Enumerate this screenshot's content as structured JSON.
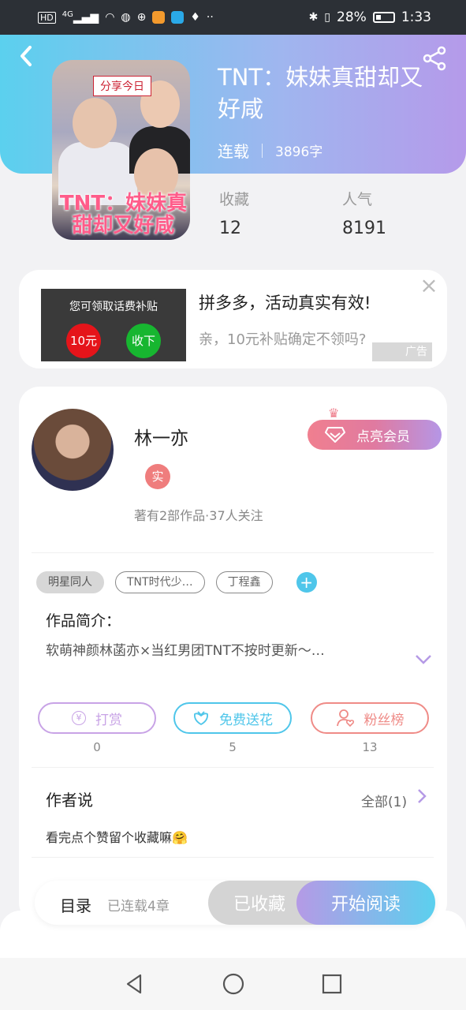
{
  "status_bar": {
    "hd": "HD",
    "signal": "4G",
    "battery": "28%",
    "time": "1:33"
  },
  "book": {
    "title": "TNT：妹妹真甜却又好咸",
    "status": "连载",
    "words": "3896字",
    "cover_tag": "分享今日",
    "cover_title": "TNT：妹妹真甜却又好咸",
    "stats": [
      {
        "label": "收藏",
        "value": "12"
      },
      {
        "label": "人气",
        "value": "8191"
      }
    ]
  },
  "ad": {
    "image_text": "您可领取话费补贴",
    "image_red": "10元",
    "image_green": "收下",
    "title": "拼多多，活动真实有效!",
    "subtitle": "亲，10元补贴确定不领吗?",
    "badge": "广告",
    "close": "×"
  },
  "author": {
    "name": "林一亦",
    "real_badge": "实",
    "meta": "著有2部作品·37人关注",
    "vip_button": "点亮会员"
  },
  "tags": [
    "明星同人",
    "TNT时代少…",
    "丁程鑫"
  ],
  "tag_add": "+",
  "intro": {
    "heading": "作品简介：",
    "text": "软萌神颜林菡亦×当红男团TNT不按时更新～…"
  },
  "actions": [
    {
      "label": "打赏",
      "count": "0",
      "color": "#c8a3e6",
      "icon": "yen-icon"
    },
    {
      "label": "免费送花",
      "count": "5",
      "color": "#4fc6ea",
      "icon": "flower-icon"
    },
    {
      "label": "粉丝榜",
      "count": "13",
      "color": "#ef8b87",
      "icon": "fan-icon"
    }
  ],
  "author_says": {
    "heading": "作者说",
    "all": "全部(1)",
    "text": "看完点个赞留个收藏嘛🤗"
  },
  "bottom_bar": {
    "toc": "目录",
    "toc_sub": "已连载4章",
    "favorited": "已收藏",
    "read": "开始阅读"
  }
}
